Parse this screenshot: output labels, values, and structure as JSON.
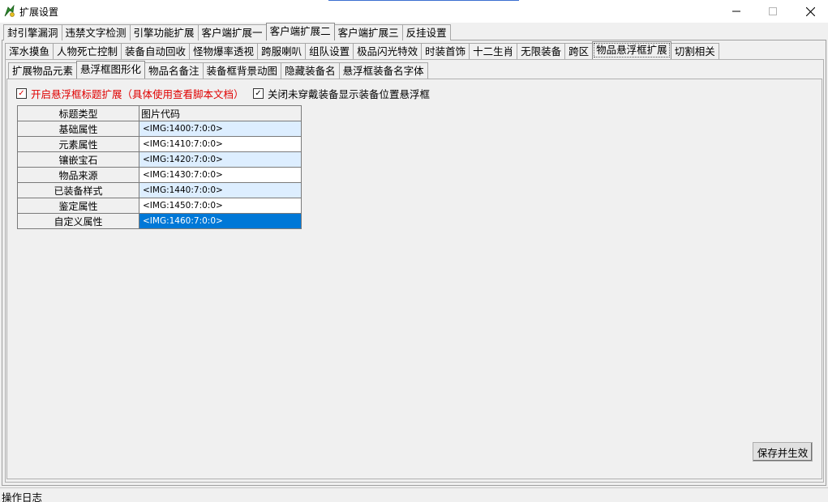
{
  "window": {
    "title": "扩展设置",
    "minimize": "—",
    "maximize": "☐",
    "close": "✕"
  },
  "tabs_row1": [
    "封引擎漏洞",
    "违禁文字检测",
    "引擎功能扩展",
    "客户端扩展一",
    "客户端扩展二",
    "客户端扩展三",
    "反挂设置"
  ],
  "tabs_row2": [
    "浑水摸鱼",
    "人物死亡控制",
    "装备自动回收",
    "怪物爆率透视",
    "跨服喇叭",
    "组队设置",
    "极品闪光特效",
    "时装首饰",
    "十二生肖",
    "无限装备",
    "跨区",
    "物品悬浮框扩展",
    "切割相关"
  ],
  "tabs_row3": [
    "扩展物品元素",
    "悬浮框图形化",
    "物品名备注",
    "装备框背景动图",
    "隐藏装备名",
    "悬浮框装备名字体"
  ],
  "options": {
    "enable_title_ext": "开启悬浮框标题扩展（具体使用查看脚本文档）",
    "enable_title_ext_checked": "✓",
    "close_unworn": "关闭未穿戴装备显示装备位置悬浮框",
    "close_unworn_checked": "✓"
  },
  "table": {
    "headers": [
      "标题类型",
      "图片代码"
    ],
    "rows": [
      {
        "type": "基础属性",
        "code": "<IMG:1400:7:0:0>"
      },
      {
        "type": "元素属性",
        "code": "<IMG:1410:7:0:0>"
      },
      {
        "type": "镶嵌宝石",
        "code": "<IMG:1420:7:0:0>"
      },
      {
        "type": "物品来源",
        "code": "<IMG:1430:7:0:0>"
      },
      {
        "type": "已装备样式",
        "code": "<IMG:1440:7:0:0>"
      },
      {
        "type": "鉴定属性",
        "code": "<IMG:1450:7:0:0>"
      },
      {
        "type": "自定义属性",
        "code": "<IMG:1460:7:0:0>"
      }
    ]
  },
  "save_button": "保存并生效",
  "status": "操作日志",
  "colors": {
    "accent": "#0078d7",
    "red_text": "#e00000",
    "row_alt": "#ddeeff"
  }
}
